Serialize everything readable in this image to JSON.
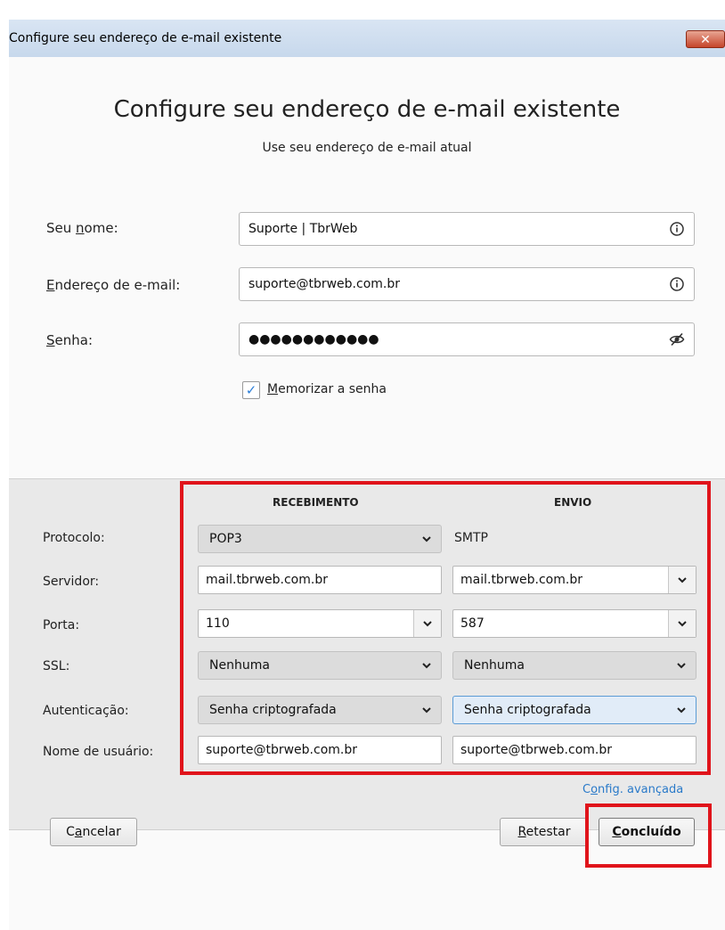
{
  "window": {
    "title": "Configure seu endereço de e-mail existente",
    "close_glyph": "✕"
  },
  "header": {
    "heading": "Configure seu endereço de e-mail existente",
    "subheading": "Use seu endereço de e-mail atual"
  },
  "form": {
    "name_label": "Seu nome:",
    "name_value": "Suporte | TbrWeb",
    "email_label": "Endereço de e-mail:",
    "email_value": "suporte@tbrweb.com.br",
    "password_label": "Senha:",
    "password_masked": "●●●●●●●●●●●●",
    "remember_label": "Memorizar a senha",
    "remember_checked": true
  },
  "server_settings": {
    "incoming_header": "RECEBIMENTO",
    "outgoing_header": "ENVIO",
    "rows": {
      "protocol_label": "Protocolo:",
      "server_label": "Servidor:",
      "port_label": "Porta:",
      "ssl_label": "SSL:",
      "auth_label": "Autenticação:",
      "username_label": "Nome de usuário:"
    },
    "incoming": {
      "protocol": "POP3",
      "server": "mail.tbrweb.com.br",
      "port": "110",
      "ssl": "Nenhuma",
      "auth": "Senha criptografada",
      "username": "suporte@tbrweb.com.br"
    },
    "outgoing": {
      "protocol": "SMTP",
      "server": "mail.tbrweb.com.br",
      "port": "587",
      "ssl": "Nenhuma",
      "auth": "Senha criptografada",
      "username": "suporte@tbrweb.com.br"
    },
    "advanced_link": "Config. avançada"
  },
  "footer": {
    "cancel": "Cancelar",
    "retest": "Retestar",
    "done": "Concluído"
  },
  "colors": {
    "highlight": "#e0141b",
    "link": "#2a7ac9",
    "check": "#2d7fd8"
  }
}
